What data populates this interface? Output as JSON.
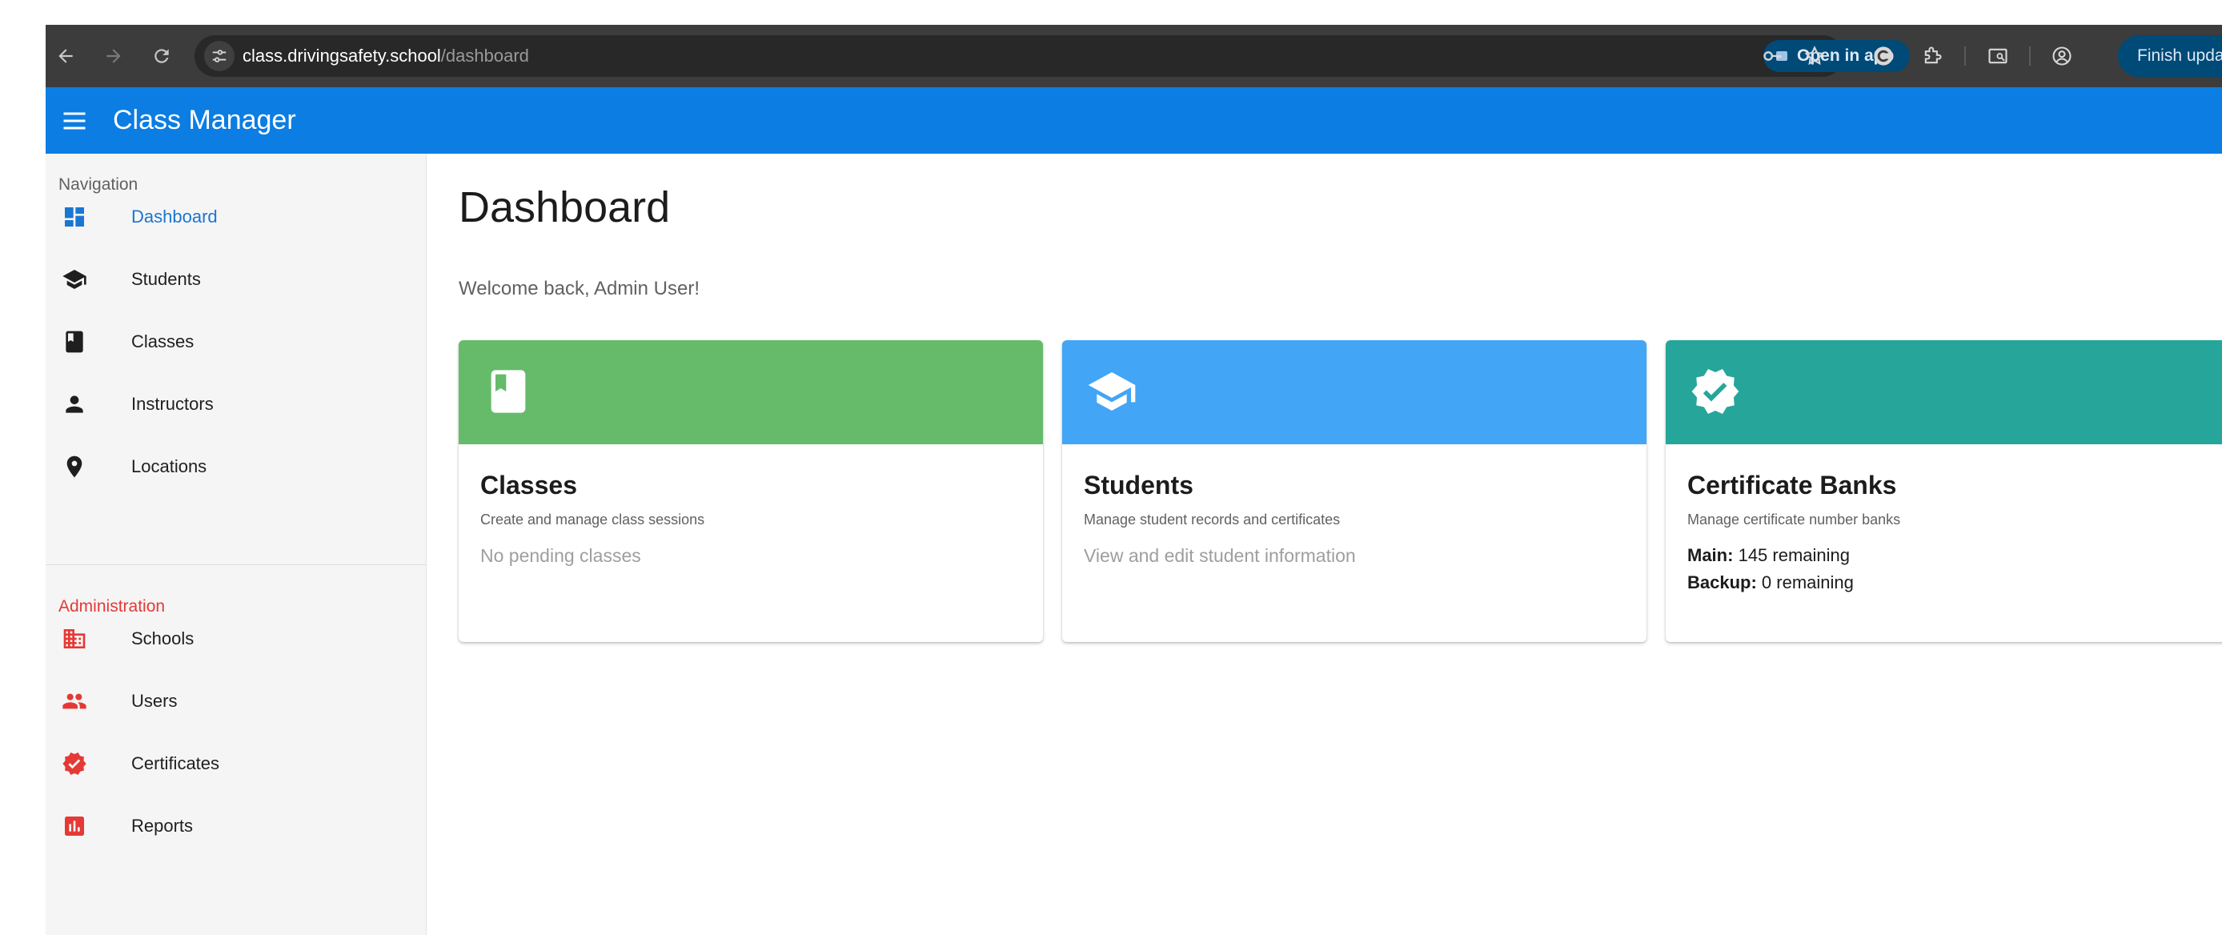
{
  "browser": {
    "url_host": "class.drivingsafety.school",
    "url_path": "/dashboard",
    "open_in_app_label": "Open in app",
    "finish_update_label": "Finish update"
  },
  "app": {
    "title": "Class Manager"
  },
  "sidebar": {
    "navigation_title": "Navigation",
    "navigation_items": [
      {
        "label": "Dashboard",
        "icon": "dashboard-icon",
        "active": true
      },
      {
        "label": "Students",
        "icon": "school-cap-icon",
        "active": false
      },
      {
        "label": "Classes",
        "icon": "book-icon",
        "active": false
      },
      {
        "label": "Instructors",
        "icon": "person-icon",
        "active": false
      },
      {
        "label": "Locations",
        "icon": "location-pin-icon",
        "active": false
      }
    ],
    "administration_title": "Administration",
    "administration_items": [
      {
        "label": "Schools",
        "icon": "building-icon"
      },
      {
        "label": "Users",
        "icon": "people-icon"
      },
      {
        "label": "Certificates",
        "icon": "verified-badge-icon"
      },
      {
        "label": "Reports",
        "icon": "bar-chart-icon"
      }
    ]
  },
  "main": {
    "page_title": "Dashboard",
    "welcome": "Welcome back, Admin User!",
    "cards": [
      {
        "title": "Classes",
        "subtitle": "Create and manage class sessions",
        "note": "No pending classes",
        "color": "#66bb6a",
        "icon": "book-icon"
      },
      {
        "title": "Students",
        "subtitle": "Manage student records and certificates",
        "note": "View and edit student information",
        "color": "#42a5f5",
        "icon": "school-cap-icon"
      },
      {
        "title": "Certificate Banks",
        "subtitle": "Manage certificate number banks",
        "color": "#26a69a",
        "icon": "verified-badge-icon",
        "banks": [
          {
            "label": "Main:",
            "value": "145 remaining"
          },
          {
            "label": "Backup:",
            "value": "0 remaining"
          }
        ]
      }
    ]
  },
  "colors": {
    "app_bar": "#0b7de3",
    "active_nav": "#1976d2",
    "admin_accent": "#e53935",
    "browser_toolbar": "#3c3c3c"
  }
}
